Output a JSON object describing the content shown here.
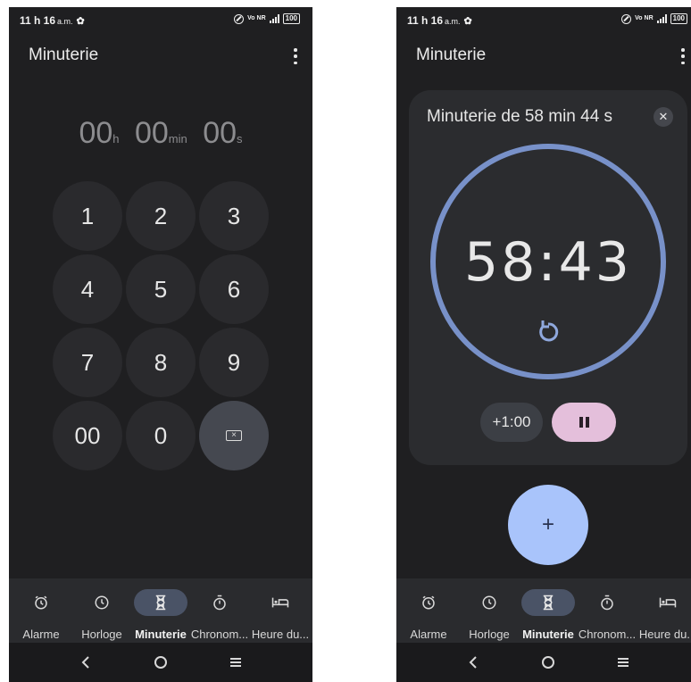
{
  "status_bar": {
    "time": "11 h 16",
    "ampm": "a.m.",
    "network": "Vo NR",
    "network_gen": "5G",
    "battery": "100"
  },
  "app": {
    "title": "Minuterie"
  },
  "keypad_screen": {
    "entry": {
      "hours": "00",
      "hours_unit": "h",
      "minutes": "00",
      "minutes_unit": "min",
      "seconds": "00",
      "seconds_unit": "s"
    },
    "keys": [
      "1",
      "2",
      "3",
      "4",
      "5",
      "6",
      "7",
      "8",
      "9",
      "00",
      "0"
    ],
    "backspace_icon": "backspace-icon"
  },
  "running_screen": {
    "card_title": "Minuterie de 58 min 44 s",
    "remaining": "58:43",
    "add_minute_label": "+1:00",
    "pause_icon": "pause-icon",
    "reset_icon": "reset-icon",
    "fab_label": "+",
    "progress_fraction": 0.998
  },
  "bottom_nav": {
    "items": [
      {
        "label": "Alarme",
        "icon": "alarm-icon"
      },
      {
        "label": "Horloge",
        "icon": "clock-icon"
      },
      {
        "label": "Minuterie",
        "icon": "hourglass-icon",
        "active": true
      },
      {
        "label": "Chronom...",
        "icon": "stopwatch-icon"
      },
      {
        "label": "Heure du...",
        "icon": "bed-icon"
      }
    ]
  },
  "colors": {
    "background": "#1f1f21",
    "ring": "#7891c9",
    "pause_button": "#e4bfdb",
    "fab": "#a9c4fb",
    "nav_active": "#4a5366"
  }
}
